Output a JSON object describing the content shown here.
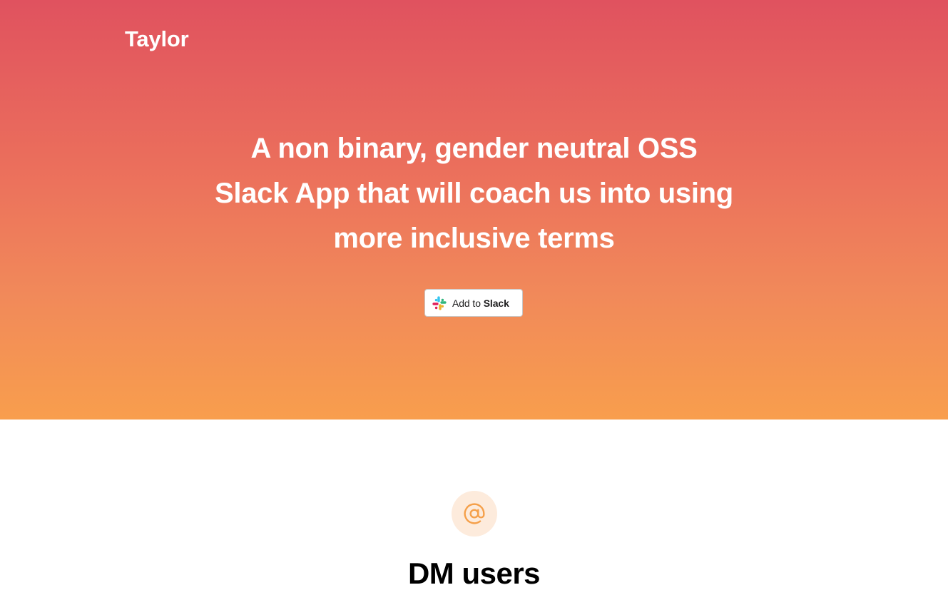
{
  "header": {
    "brand": "Taylor"
  },
  "hero": {
    "headline_lines": [
      "A non binary, gender neutral OSS",
      "Slack App that will coach us into using",
      "more inclusive terms"
    ],
    "cta": {
      "prefix": "Add to",
      "brand": "Slack",
      "icon": "slack-logo-icon"
    },
    "gradient": [
      "#e0525f",
      "#f89e4d"
    ]
  },
  "features": [
    {
      "icon": "at-sign-icon",
      "title": "DM users",
      "accent": "#f5a04a",
      "icon_bg": "#fdebdc"
    }
  ]
}
